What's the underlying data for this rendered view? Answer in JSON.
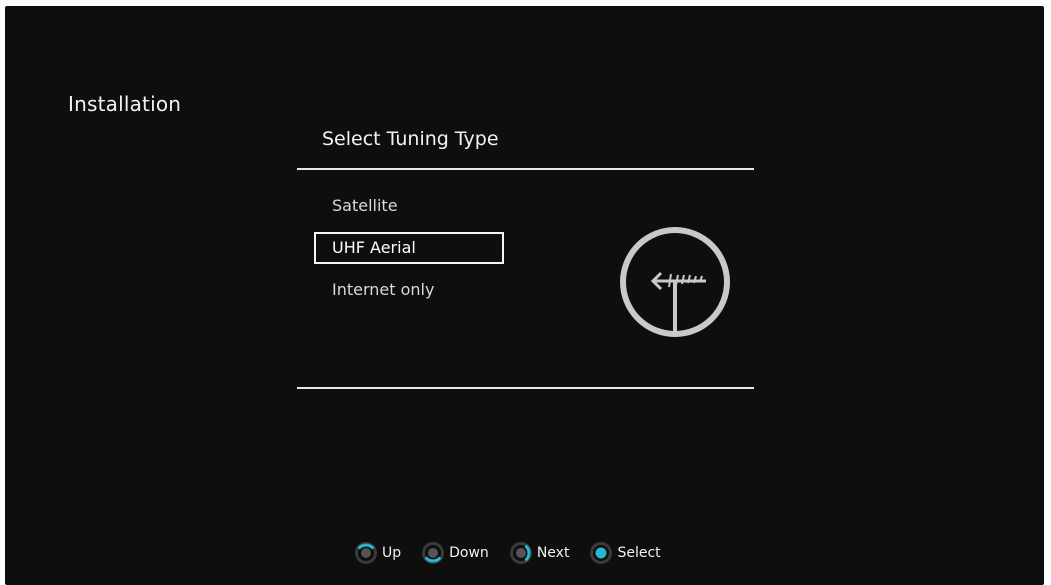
{
  "screen": {
    "section_title": "Installation",
    "dialog_title": "Select Tuning Type"
  },
  "options": [
    {
      "label": "Satellite",
      "selected": false
    },
    {
      "label": "UHF Aerial",
      "selected": true
    },
    {
      "label": "Internet only",
      "selected": false
    }
  ],
  "illustration": {
    "icon": "uhf-aerial-antenna-icon"
  },
  "hints": [
    {
      "label": "Up",
      "icon": "remote-dpad-up-icon"
    },
    {
      "label": "Down",
      "icon": "remote-dpad-down-icon"
    },
    {
      "label": "Next",
      "icon": "remote-dpad-right-icon"
    },
    {
      "label": "Select",
      "icon": "remote-ok-button-icon"
    }
  ],
  "colors": {
    "background": "#0e0e0d",
    "text": "#f2f2f2",
    "dpad_ring": "#3a3a3a",
    "dpad_highlight": "#29b6d6",
    "icon_stroke": "#c9c9c9"
  }
}
